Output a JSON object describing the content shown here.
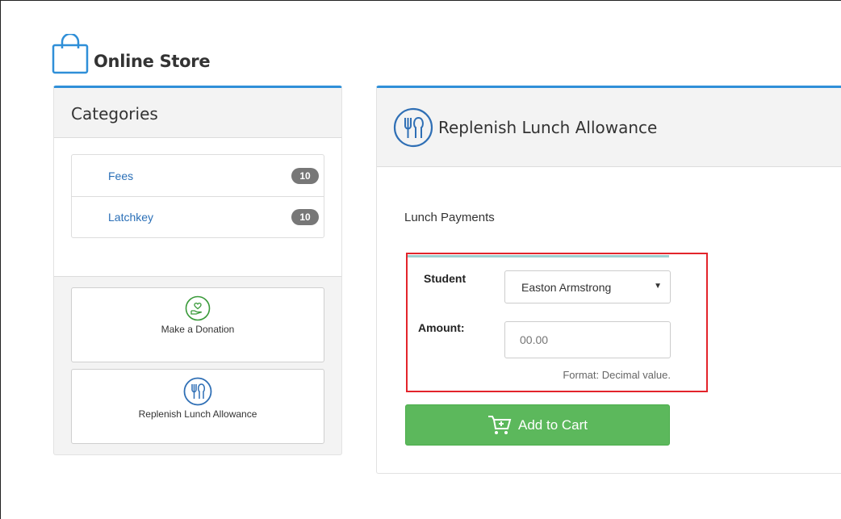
{
  "store": {
    "title": "Online Store"
  },
  "sidebar": {
    "heading": "Categories",
    "categories": [
      {
        "label": "Fees",
        "count": "10"
      },
      {
        "label": "Latchkey",
        "count": "10"
      }
    ],
    "tiles": [
      {
        "label": "Make a Donation",
        "icon": "donation-hand-heart-icon"
      },
      {
        "label": "Replenish Lunch Allowance",
        "icon": "utensils-icon"
      }
    ]
  },
  "panel": {
    "title": "Replenish Lunch Allowance",
    "icon": "utensils-icon",
    "section_title": "Lunch Payments",
    "form": {
      "student_label": "Student",
      "student_value": "Easton Armstrong",
      "amount_label": "Amount:",
      "amount_placeholder": "00.00",
      "amount_hint": "Format: Decimal value."
    },
    "add_to_cart_label": "Add to Cart"
  },
  "colors": {
    "accent_blue": "#2f8fd8",
    "link_blue": "#2a6fb7",
    "success_green": "#5cb85c",
    "highlight_red": "#e3242b",
    "badge_gray": "#777777"
  }
}
